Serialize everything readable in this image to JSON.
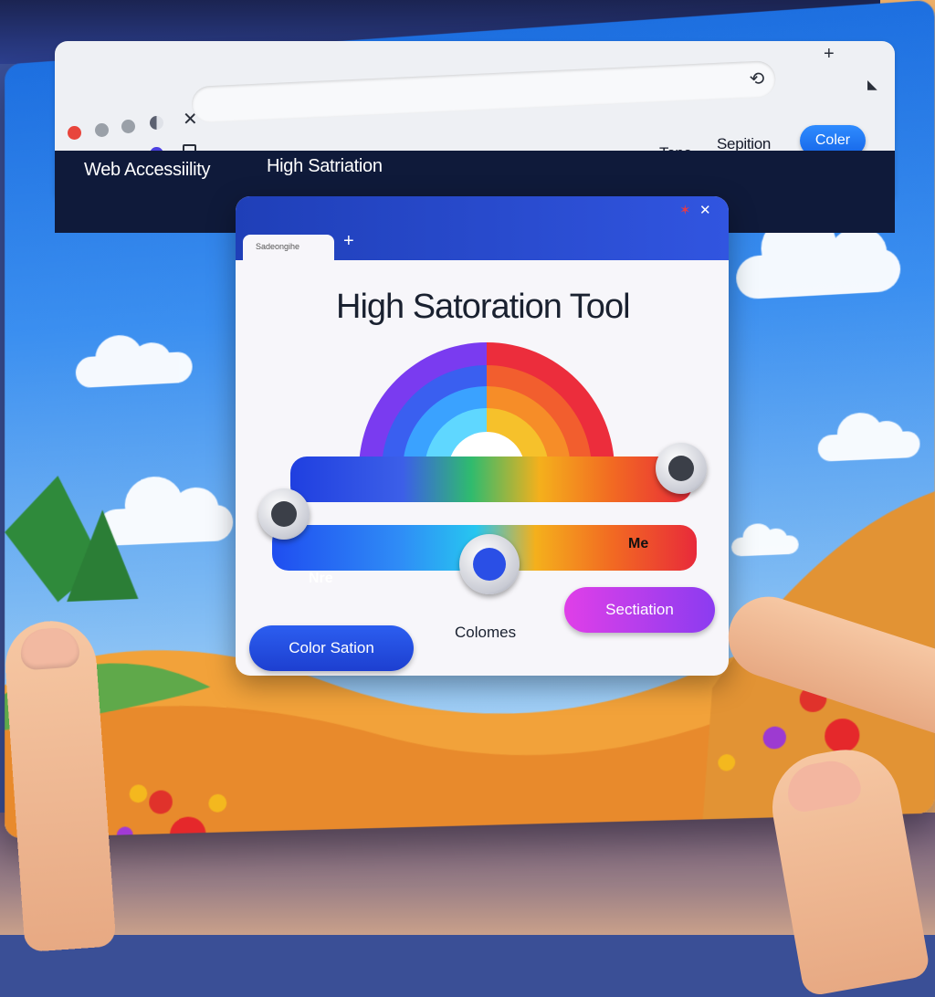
{
  "browser": {
    "tabs": {
      "tone": "Tone",
      "sepition": "Sepition",
      "color_button": "Coler"
    },
    "nav": {
      "web_accessibility": "Web Accessiility",
      "high_saturation": "High Satriation"
    }
  },
  "dialog": {
    "tab_label": "Sadeongihe",
    "title": "High Satoration Tool",
    "slider_labels": {
      "left": "Nre",
      "right": "Me"
    },
    "center_label": "Colomes",
    "buttons": {
      "color_sation": "Color Sation",
      "sectiation": "Sectiation"
    }
  },
  "sliders": {
    "top_value_fraction": 0.97,
    "bottom_value_fraction": 0.5
  },
  "colors": {
    "nav_bg": "#0f1a3a",
    "accent_blue": "#1d3fd0",
    "accent_magenta": "#e03fe8",
    "close_accent": "#e23b4b"
  },
  "icons": [
    "plus-icon",
    "close-icon",
    "refresh-icon",
    "tab-icon",
    "pin-icon"
  ]
}
